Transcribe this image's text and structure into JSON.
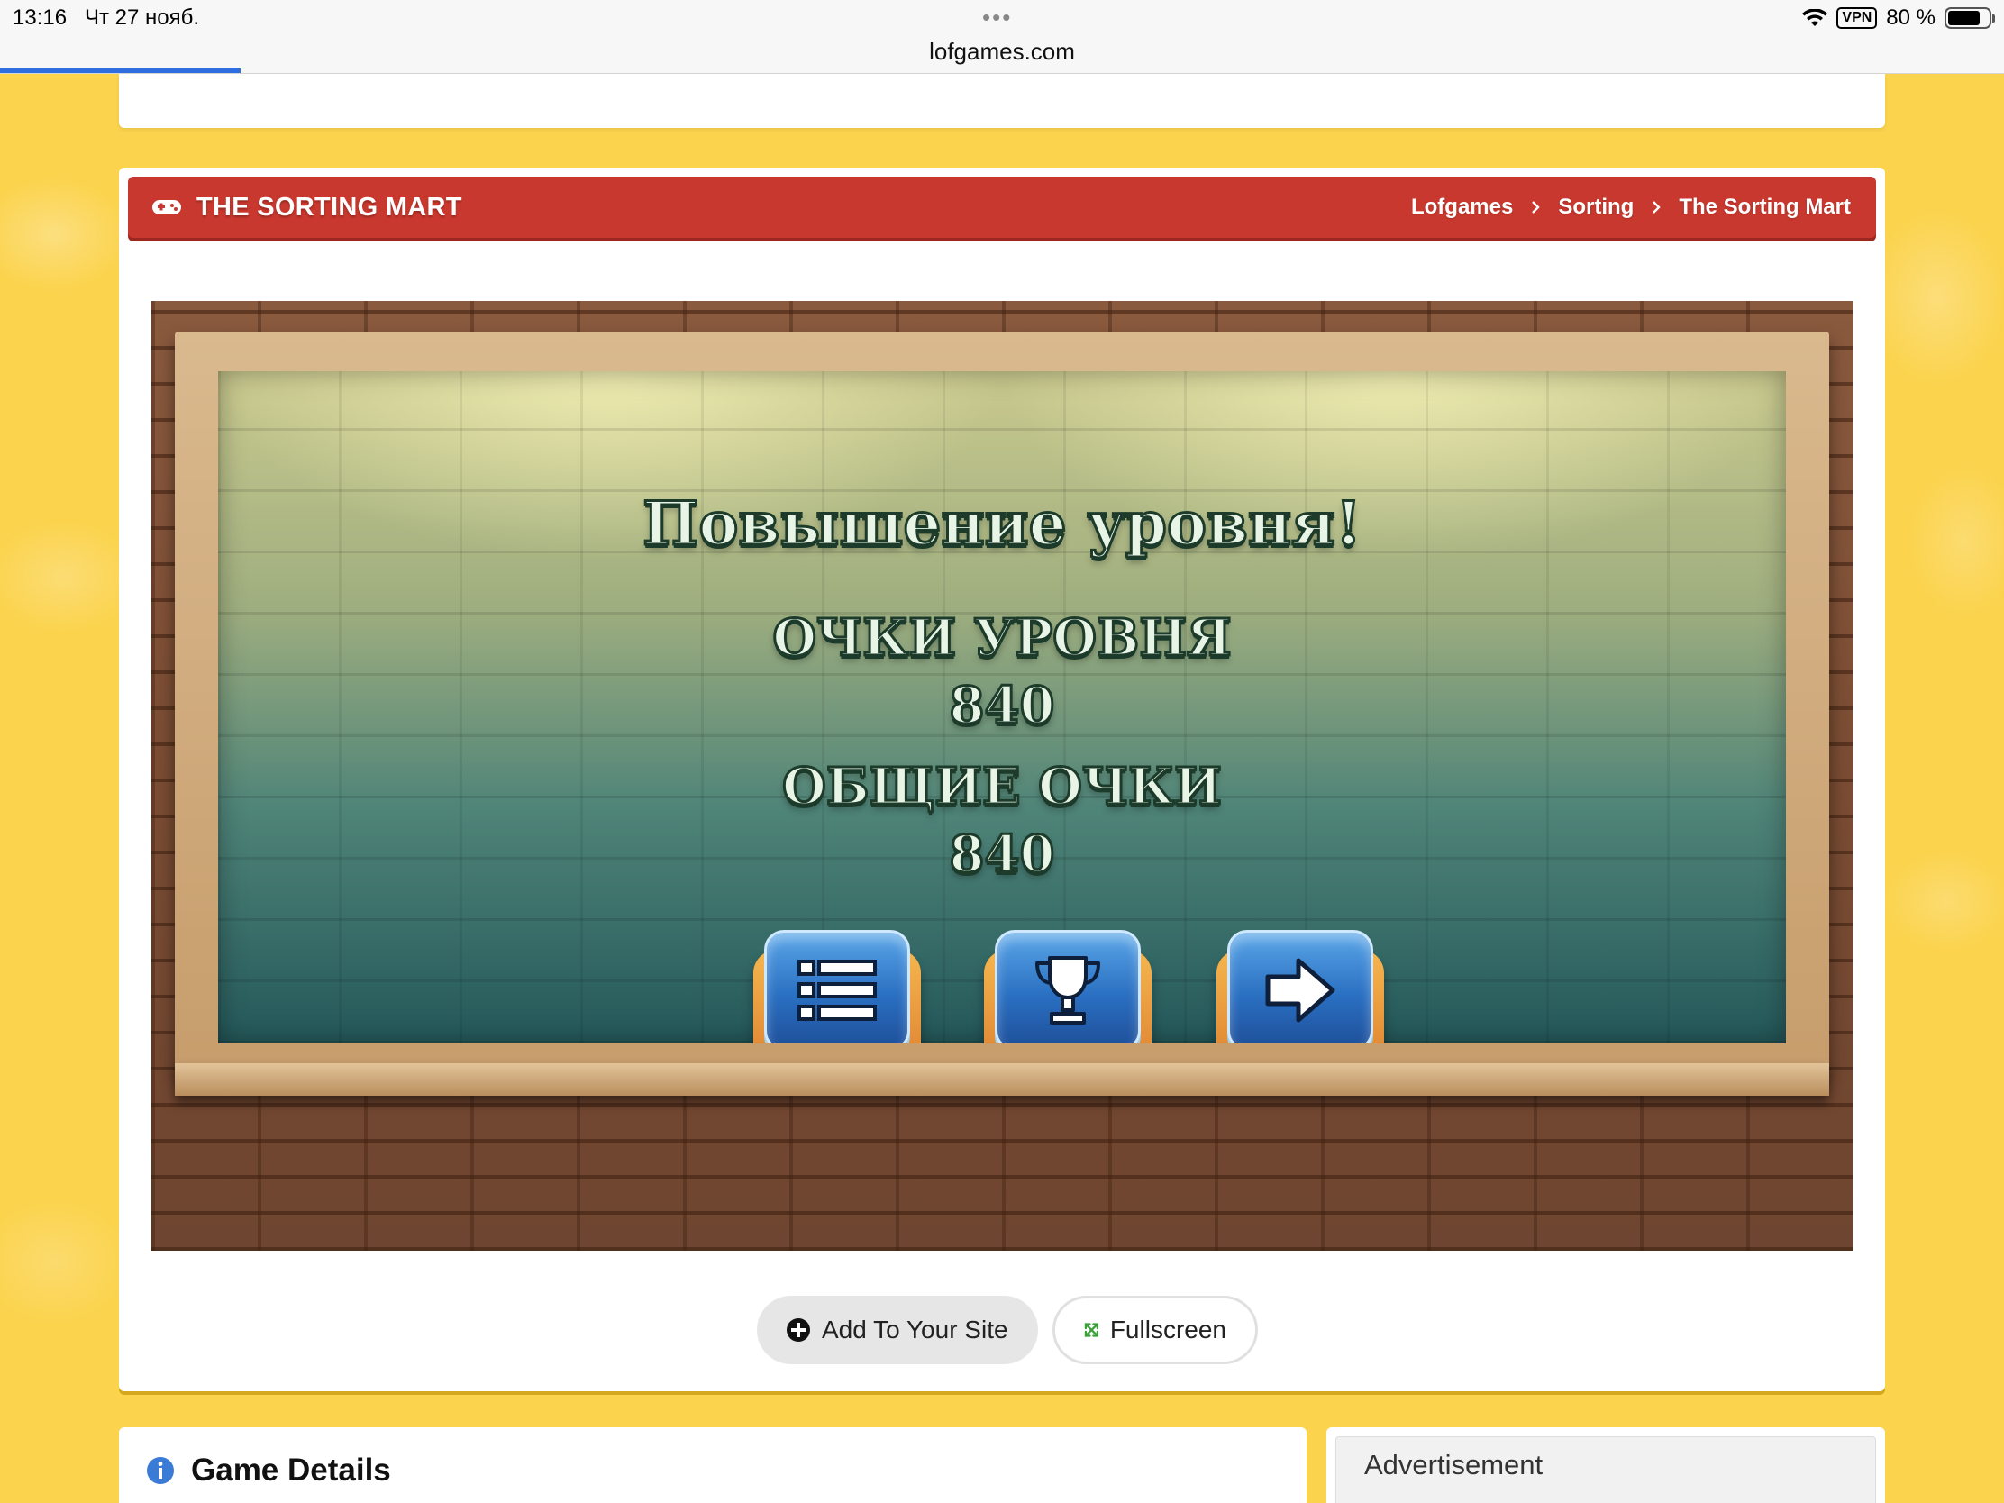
{
  "status_bar": {
    "time": "13:16",
    "date": "Чт 27 нояб.",
    "url": "lofgames.com",
    "vpn": "VPN",
    "battery": "80 %",
    "battery_level": 0.8,
    "page_load_progress": 0.12
  },
  "header": {
    "title": "THE SORTING MART",
    "icon": "gamepad-icon",
    "breadcrumbs": [
      "Lofgames",
      "Sorting",
      "The Sorting Mart"
    ]
  },
  "game": {
    "headline": "Повышение уровня!",
    "level_points_label": "ОЧКИ УРОВНЯ",
    "level_points_value": "840",
    "total_points_label": "ОБЩИЕ ОЧКИ",
    "total_points_value": "840",
    "buttons": [
      {
        "icon": "list-icon"
      },
      {
        "icon": "trophy-icon"
      },
      {
        "icon": "arrow-right-icon"
      }
    ]
  },
  "controls": {
    "add_label": "Add To Your Site",
    "fullscreen_label": "Fullscreen"
  },
  "details": {
    "title": "Game Details"
  },
  "ad": {
    "title": "Advertisement"
  },
  "colors": {
    "page_bg": "#fbd34d",
    "header_red": "#c9382e",
    "link_blue": "#2f6ee0",
    "fullscreen_green": "#3aa03a"
  }
}
